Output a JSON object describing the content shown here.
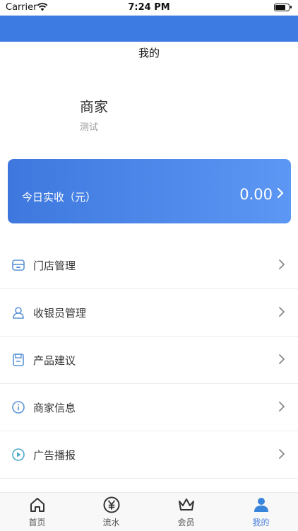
{
  "status": {
    "carrier": "Carrier",
    "time": "7:24 PM"
  },
  "nav": {
    "title": "我的"
  },
  "merchant": {
    "name": "商家",
    "subtitle": "测试"
  },
  "income": {
    "label": "今日实收（元）",
    "amount": "0.00"
  },
  "menu": [
    {
      "label": "门店管理",
      "icon": "store-icon"
    },
    {
      "label": "收银员管理",
      "icon": "user-icon"
    },
    {
      "label": "产品建议",
      "icon": "save-icon"
    },
    {
      "label": "商家信息",
      "icon": "info-icon"
    },
    {
      "label": "广告播报",
      "icon": "broadcast-icon"
    }
  ],
  "tabs": [
    {
      "label": "首页",
      "icon": "home-icon"
    },
    {
      "label": "流水",
      "icon": "yen-icon"
    },
    {
      "label": "会员",
      "icon": "crown-icon"
    },
    {
      "label": "我的",
      "icon": "person-icon",
      "active": true
    }
  ],
  "colors": {
    "accent": "#3d7be2",
    "active_tab": "#4a7fd8"
  }
}
